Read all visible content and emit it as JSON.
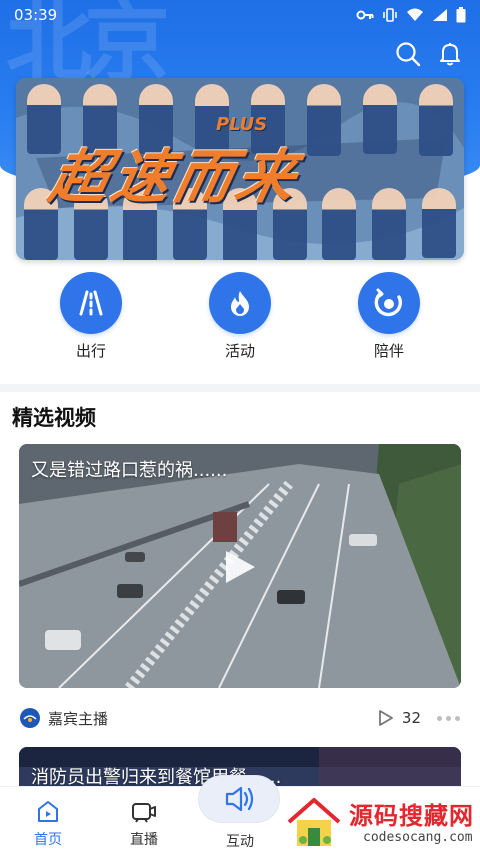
{
  "status_bar": {
    "time": "03:39"
  },
  "header": {
    "watermark_glyph": "北京"
  },
  "banner": {
    "title": "超速而来",
    "tag": "PLUS"
  },
  "quick_nav": [
    {
      "label": "出行",
      "icon": "road-icon"
    },
    {
      "label": "活动",
      "icon": "flame-icon"
    },
    {
      "label": "陪伴",
      "icon": "companion-icon"
    }
  ],
  "section": {
    "title": "精选视频"
  },
  "videos": [
    {
      "title": "又是错过路口惹的祸......",
      "author": "嘉宾主播",
      "play_count": "32"
    },
    {
      "title": "消防员出警归来到餐馆用餐......"
    }
  ],
  "bottom_nav": [
    {
      "label": "首页",
      "icon": "home-play-icon",
      "active": true
    },
    {
      "label": "直播",
      "icon": "live-camera-icon",
      "active": false
    },
    {
      "label": "互动",
      "icon": "interact-sound-icon",
      "active": false
    }
  ],
  "watermark": {
    "name": "源码搜藏网",
    "url": "codesocang.com"
  },
  "colors": {
    "primary": "#2f74e8",
    "header_blue": "#1f6fe6",
    "logo_red": "#e2282f"
  }
}
